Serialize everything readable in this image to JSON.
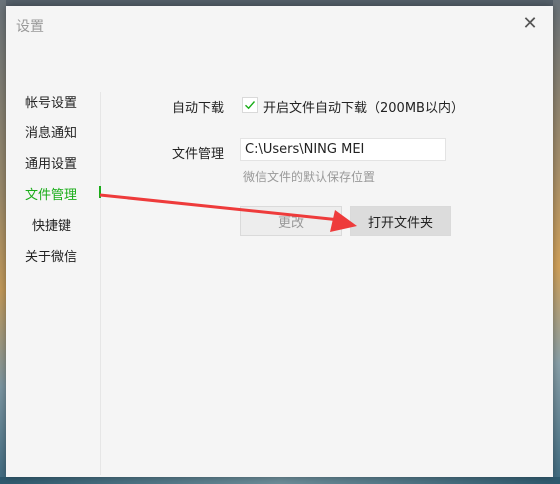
{
  "window": {
    "title": "设置",
    "close_glyph": "✕"
  },
  "sidebar": {
    "items": [
      {
        "label": "帐号设置",
        "active": false
      },
      {
        "label": "消息通知",
        "active": false
      },
      {
        "label": "通用设置",
        "active": false
      },
      {
        "label": "文件管理",
        "active": true
      },
      {
        "label": "快捷键",
        "active": false
      },
      {
        "label": "关于微信",
        "active": false
      }
    ]
  },
  "auto_download": {
    "label": "自动下载",
    "checkbox_checked": true,
    "checkbox_label": "开启文件自动下载（200MB以内）"
  },
  "file_management": {
    "label": "文件管理",
    "path_value": "C:\\Users\\NING MEI",
    "hint": "微信文件的默认保存位置"
  },
  "buttons": {
    "change_label": "更改",
    "open_folder_label": "打开文件夹"
  },
  "colors": {
    "accent_green": "#1aad19",
    "annotation_red": "#ee3b3b"
  }
}
